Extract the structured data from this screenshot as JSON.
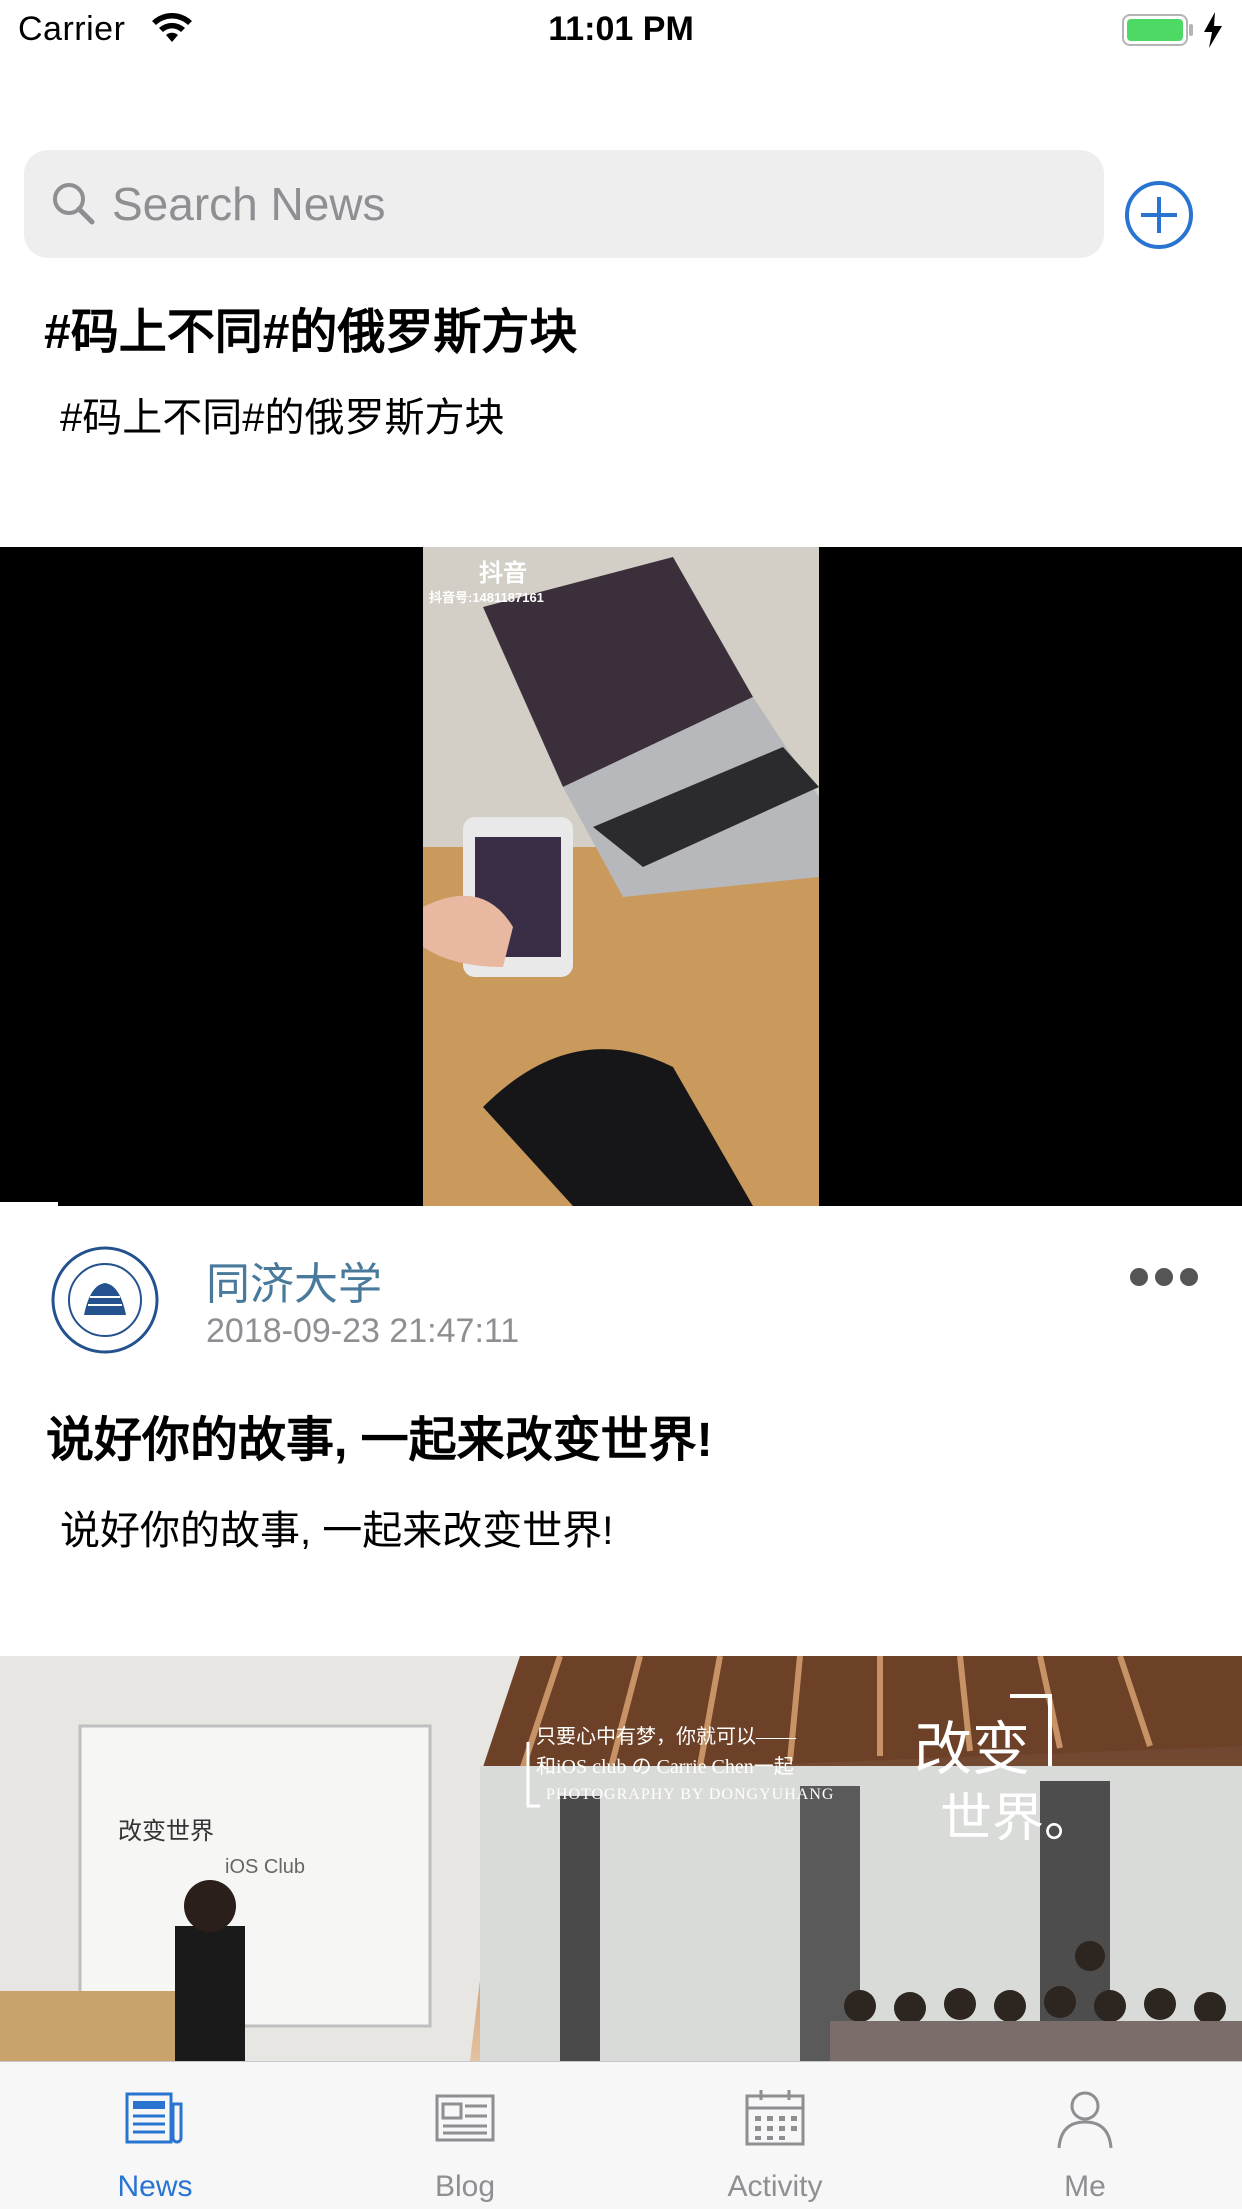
{
  "status_bar": {
    "carrier": "Carrier",
    "time": "11:01 PM",
    "battery_level": 1.0
  },
  "search": {
    "placeholder": "Search News"
  },
  "feed": {
    "post1": {
      "title": "#码上不同#的俄罗斯方块",
      "body": "#码上不同#的俄罗斯方块",
      "video": {
        "watermark_app": "抖音",
        "watermark_id": "抖音号:1481187161"
      }
    },
    "post2": {
      "author": "同济大学",
      "timestamp": "2018-09-23 21:47:11",
      "title": "说好你的故事, 一起来改变世界!",
      "body": "说好你的故事, 一起来改变世界!",
      "image": {
        "slide_title": "改变世界",
        "slide_sub": "iOS Club",
        "caption_line1": "只要心中有梦，你就可以——",
        "caption_line2": "和iOS club の Carrie Chen一起",
        "caption_line3": "PHOTOGRAPHY BY DONGYUHANG",
        "big_text1": "改变",
        "big_text2": "世界。"
      }
    }
  },
  "tabbar": {
    "active_color": "#2a74d1",
    "inactive_color": "#8e8e93",
    "tabs": [
      {
        "label": "News",
        "icon": "newspaper-icon"
      },
      {
        "label": "Blog",
        "icon": "blog-icon"
      },
      {
        "label": "Activity",
        "icon": "calendar-icon"
      },
      {
        "label": "Me",
        "icon": "person-icon"
      }
    ]
  }
}
